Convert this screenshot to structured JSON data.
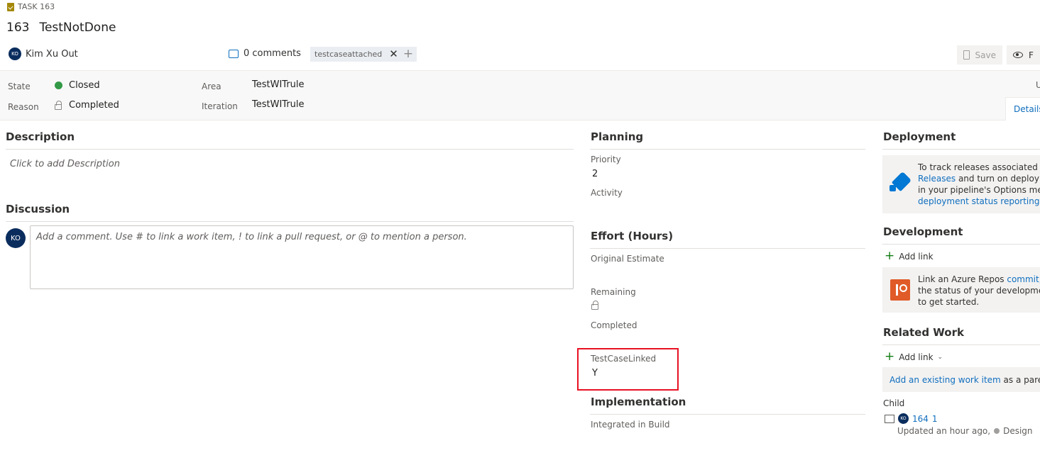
{
  "header": {
    "work_item_type": "TASK 163",
    "id": "163",
    "title": "TestNotDone",
    "assigned_to": "Kim Xu Out",
    "assigned_initials": "KO",
    "comments": "0 comments",
    "tag": "testcaseattached",
    "save_label": "Save",
    "follow_label": "F"
  },
  "fields": {
    "state_label": "State",
    "state_value": "Closed",
    "reason_label": "Reason",
    "reason_value": "Completed",
    "area_label": "Area",
    "area_value": "TestWITrule",
    "iteration_label": "Iteration",
    "iteration_value": "TestWITrule",
    "updated_label": "U",
    "details_tab": "Details"
  },
  "description": {
    "title": "Description",
    "placeholder": "Click to add Description"
  },
  "discussion": {
    "title": "Discussion",
    "avatar": "KO",
    "placeholder": "Add a comment. Use # to link a work item, ! to link a pull request, or @ to mention a person."
  },
  "planning": {
    "title": "Planning",
    "priority_label": "Priority",
    "priority_value": "2",
    "activity_label": "Activity"
  },
  "effort": {
    "title": "Effort (Hours)",
    "original_label": "Original Estimate",
    "remaining_label": "Remaining",
    "completed_label": "Completed",
    "testcase_label": "TestCaseLinked",
    "testcase_value": "Y"
  },
  "implementation": {
    "title": "Implementation",
    "build_label": "Integrated in Build"
  },
  "deployment": {
    "title": "Deployment",
    "line1": "To track releases associated with",
    "line2_link": "Releases",
    "line2_rest": " and turn on deployment",
    "line3": "in your pipeline's Options menu.",
    "line4_link": "deployment status reporting"
  },
  "development": {
    "title": "Development",
    "add_link": "Add link",
    "line1_text": "Link an Azure Repos ",
    "line1_link": "commit, pul",
    "line2": "the status of your development.",
    "line3": "to get started."
  },
  "related": {
    "title": "Related Work",
    "add_link": "Add link",
    "existing_link": "Add an existing work item",
    "existing_rest": " as a parent",
    "child_label": "Child",
    "child_initials": "KO",
    "child_id": "164",
    "child_title": "1",
    "child_updated": "Updated an hour ago,",
    "child_state": "Design"
  },
  "colors": {
    "accent": "#106ebe",
    "state_closed": "#339947",
    "highlight": "#e81123"
  }
}
